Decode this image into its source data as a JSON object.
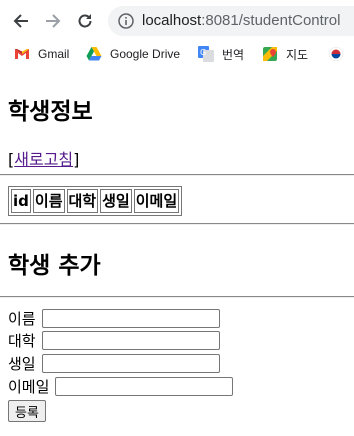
{
  "browser": {
    "url_host": "localhost",
    "url_rest": ":8081/studentControl",
    "bookmarks": [
      "Gmail",
      "Google Drive",
      "번역",
      "지도"
    ]
  },
  "page": {
    "title": "학생정보",
    "refresh_open": "[",
    "refresh_label": "새로고침",
    "refresh_close": "]",
    "table_headers": [
      "id",
      "이름",
      "대학",
      "생일",
      "이메일"
    ],
    "form_title": "학생 추가",
    "form_fields": [
      {
        "label": "이름",
        "value": ""
      },
      {
        "label": "대학",
        "value": ""
      },
      {
        "label": "생일",
        "value": ""
      },
      {
        "label": "이메일",
        "value": ""
      }
    ],
    "submit_label": "등록"
  }
}
